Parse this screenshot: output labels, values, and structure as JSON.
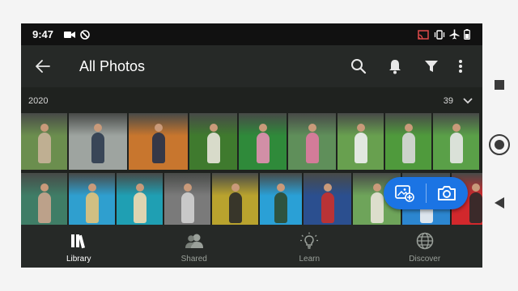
{
  "status_bar": {
    "time": "9:47",
    "left_icons": [
      "video-camera-icon",
      "do-not-disturb-icon"
    ],
    "right_icons": [
      "cast-icon",
      "vibrate-icon",
      "airplane-mode-icon",
      "battery-icon"
    ]
  },
  "app_bar": {
    "title": "All Photos",
    "back_icon": "back-arrow-icon",
    "actions": [
      "search-icon",
      "notifications-bell-icon",
      "filter-icon",
      "more-vertical-icon"
    ]
  },
  "section": {
    "year": "2020",
    "count": "39",
    "collapse_icon": "chevron-down-icon"
  },
  "grid": {
    "row1": [
      {
        "bg": "#6b8e4e",
        "accent": "#c9b29a"
      },
      {
        "bg": "#9ea4a0",
        "accent": "#2e3c4f"
      },
      {
        "bg": "#c8762e",
        "accent": "#26324a"
      },
      {
        "bg": "#3f7a2e",
        "accent": "#e9e6dc"
      },
      {
        "bg": "#2f8a3a",
        "accent": "#e38fb3"
      },
      {
        "bg": "#5f8f5a",
        "accent": "#e07aa0"
      },
      {
        "bg": "#68a04f",
        "accent": "#f0f0f0"
      },
      {
        "bg": "#4f9a3c",
        "accent": "#d9d9d9"
      },
      {
        "bg": "#5aa048",
        "accent": "#e8e8e8"
      }
    ],
    "row2": [
      {
        "bg": "#3f7d66",
        "accent": "#caa58e"
      },
      {
        "bg": "#2f9fcf",
        "accent": "#e2c27a"
      },
      {
        "bg": "#1f9fb3",
        "accent": "#f2d9b0"
      },
      {
        "bg": "#7a7a7a",
        "accent": "#d0d0d0"
      },
      {
        "bg": "#b9a32e",
        "accent": "#2a2a2a"
      },
      {
        "bg": "#2aa0d6",
        "accent": "#2f4a2f"
      },
      {
        "bg": "#2b4f8f",
        "accent": "#c9302c"
      },
      {
        "bg": "#6ea45a",
        "accent": "#e9e4d8"
      },
      {
        "bg": "#2c86d0",
        "accent": "#f0f0f0"
      },
      {
        "bg": "#d2282c",
        "accent": "#2a2a2a"
      }
    ]
  },
  "fab": {
    "import_icon": "add-photo-icon",
    "camera_icon": "camera-icon",
    "color": "#1b74e4"
  },
  "bottom_nav": {
    "items": [
      {
        "label": "Library",
        "icon": "library-books-icon",
        "active": true
      },
      {
        "label": "Shared",
        "icon": "shared-people-icon",
        "active": false
      },
      {
        "label": "Learn",
        "icon": "lightbulb-icon",
        "active": false
      },
      {
        "label": "Discover",
        "icon": "globe-icon",
        "active": false
      }
    ]
  },
  "system_nav": [
    "recents-square-icon",
    "home-circle-icon",
    "back-triangle-icon"
  ]
}
